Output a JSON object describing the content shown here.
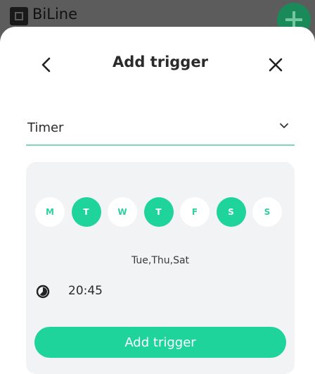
{
  "background_app": {
    "title": "BiLine"
  },
  "header": {
    "title": "Add trigger"
  },
  "trigger_type": {
    "selected": "Timer"
  },
  "days": [
    {
      "label": "M",
      "selected": false
    },
    {
      "label": "T",
      "selected": true
    },
    {
      "label": "W",
      "selected": false
    },
    {
      "label": "T",
      "selected": true
    },
    {
      "label": "F",
      "selected": false
    },
    {
      "label": "S",
      "selected": true
    },
    {
      "label": "S",
      "selected": false
    }
  ],
  "days_summary": "Tue,Thu,Sat",
  "time": "20:45",
  "add_button_label": "Add trigger",
  "colors": {
    "accent": "#1ed49a",
    "underline": "#7fd8b6",
    "panel": "#f2f3f4"
  },
  "icons": {
    "back": "chevron-left-icon",
    "close": "close-icon",
    "dropdown": "chevron-down-icon",
    "clock": "clock-icon",
    "fab": "plus-icon"
  }
}
